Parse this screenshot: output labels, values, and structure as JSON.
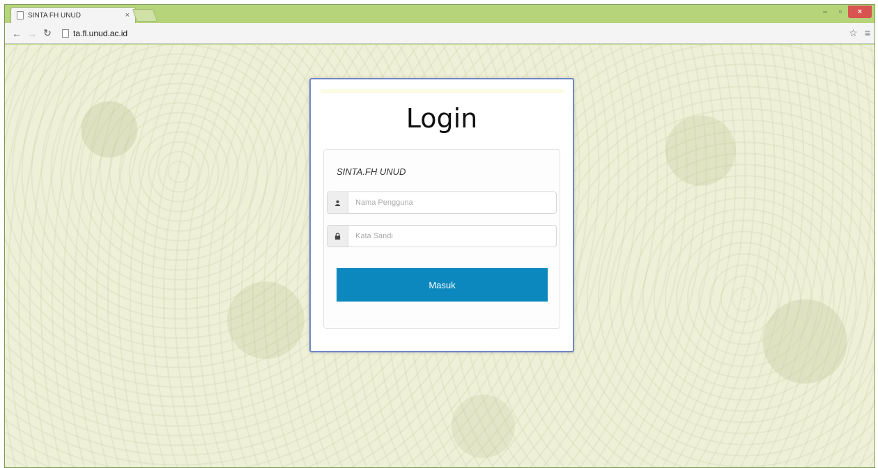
{
  "browser": {
    "tab_title": "SINTA FH UNUD",
    "tab_close": "×",
    "url": "ta.fl.unud.ac.id",
    "window_controls": {
      "minimize": "–",
      "maximize": "▫",
      "close": "×"
    }
  },
  "login": {
    "heading": "Login",
    "brand": "SINTA.FH UNUD",
    "username_placeholder": "Nama Pengguna",
    "password_placeholder": "Kata Sandi",
    "submit_label": "Masuk"
  },
  "icons": {
    "back": "back-arrow-icon",
    "forward": "forward-arrow-icon",
    "reload": "reload-icon",
    "page": "page-icon",
    "star": "star-icon",
    "menu": "menu-icon",
    "user": "user-icon",
    "lock": "lock-icon"
  },
  "colors": {
    "chrome_frame": "#b6d47a",
    "card_border": "#6f86c4",
    "button": "#0d88be",
    "page_background": "#eef0d8"
  }
}
